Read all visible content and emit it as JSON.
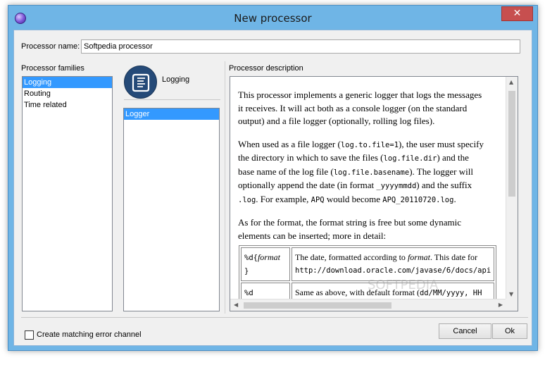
{
  "window": {
    "title": "New processor",
    "close_glyph": "✕",
    "app_icon": "purple-orb-icon"
  },
  "processor_name": {
    "label": "Processor name:",
    "value": "Softpedia processor"
  },
  "families": {
    "label": "Processor families",
    "items": [
      "Logging",
      "Routing",
      "Time related"
    ],
    "selected": "Logging"
  },
  "selected_family": {
    "title": "Logging",
    "icon": "scroll-icon"
  },
  "processors": {
    "items": [
      "Logger"
    ],
    "selected": "Logger"
  },
  "description": {
    "label": "Processor description",
    "p1_lines": [
      "This processor implements a generic logger that logs the messages",
      "it receives. It will act both as a console logger (on the standard",
      "output) and a file logger (optionally, rolling log files)."
    ],
    "p2": {
      "l1a": "When used as a file logger (",
      "l1code": "log.to.file=1",
      "l1b": "), the user must specify",
      "l2a": "the directory in which to save the files (",
      "l2code": "log.file.dir",
      "l2b": ") and the",
      "l3a": "base name of the log file (",
      "l3code": "log.file.basename",
      "l3b": "). The logger will",
      "l4a": "optionally append the date (in format ",
      "l4code": "_yyyymmdd",
      "l4b": ") and the suffix",
      "l5code1": ".log",
      "l5a": ". For example, ",
      "l5code2": "APQ",
      "l5b": " would become ",
      "l5code3": "APQ_20110720.log",
      "l5c": "."
    },
    "p3_lines": [
      "As for the format, the format string is free but some dynamic",
      "elements can be inserted; more in detail:"
    ],
    "table": {
      "r1_key_a": "%d{",
      "r1_key_italic": "format",
      "r1_key_b": "}",
      "r1_val_a": "The date, formatted according to ",
      "r1_val_italic": "format",
      "r1_val_b": ". This date for",
      "r1_val_url": "http://download.oracle.com/javase/6/docs/api",
      "r2_key": "%d",
      "r2_val_a": "Same as above, with default format (",
      "r2_val_code": "dd/MM/yyyy, HH",
      "r2_val_b": ""
    }
  },
  "error_channel": {
    "label": "Create matching error channel",
    "checked": false
  },
  "buttons": {
    "cancel": "Cancel",
    "ok": "Ok"
  },
  "scroll": {
    "up": "▲",
    "down": "▼",
    "left": "◀",
    "right": "▶"
  },
  "watermark": "SOFTPEDIA"
}
